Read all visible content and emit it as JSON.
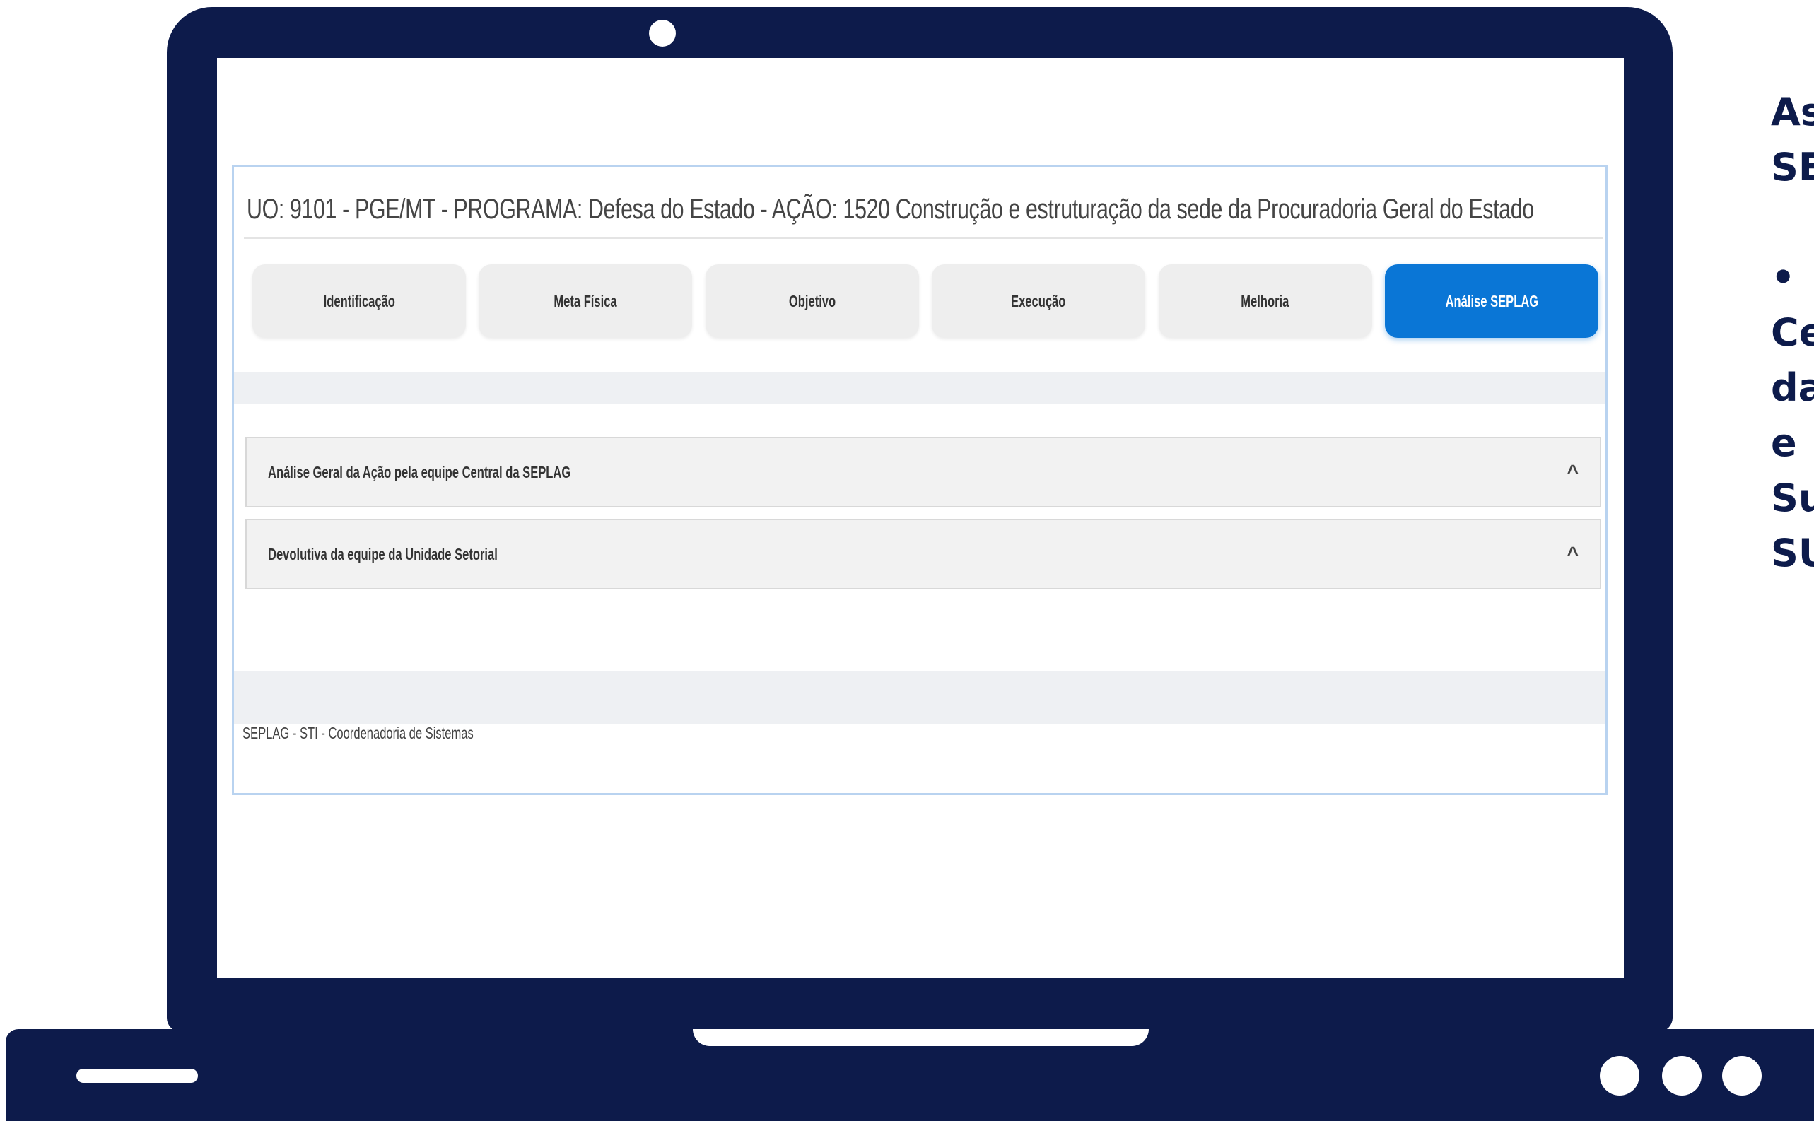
{
  "header": {
    "title": "UO: 9101 - PGE/MT - PROGRAMA: Defesa do Estado - AÇÃO: 1520 Construção e estruturação da sede da Procuradoria Geral do Estado"
  },
  "tabs": [
    {
      "label": "Identificação",
      "active": false
    },
    {
      "label": "Meta Física",
      "active": false
    },
    {
      "label": "Objetivo",
      "active": false
    },
    {
      "label": "Execução",
      "active": false
    },
    {
      "label": "Melhoria",
      "active": false
    },
    {
      "label": "Análise SEPLAG",
      "active": true
    }
  ],
  "accordions": [
    {
      "label": "Análise Geral da Ação pela equipe Central da SEPLAG",
      "icon": "chevron-up-icon"
    },
    {
      "label": "Devolutiva da equipe da Unidade Setorial",
      "icon": "chevron-up-icon"
    }
  ],
  "footer": {
    "text": "SEPLAG - STI - Coordenadoria de Sistemas"
  },
  "side_text": {
    "lines_a": [
      "As",
      "SE"
    ],
    "bullet": "•",
    "lines_b": [
      "Ce",
      "da",
      "e",
      "Su",
      "SU"
    ]
  },
  "colors": {
    "frame": "#0d1b4b",
    "active_tab": "#0a76d6",
    "border": "#b9d3f0"
  }
}
